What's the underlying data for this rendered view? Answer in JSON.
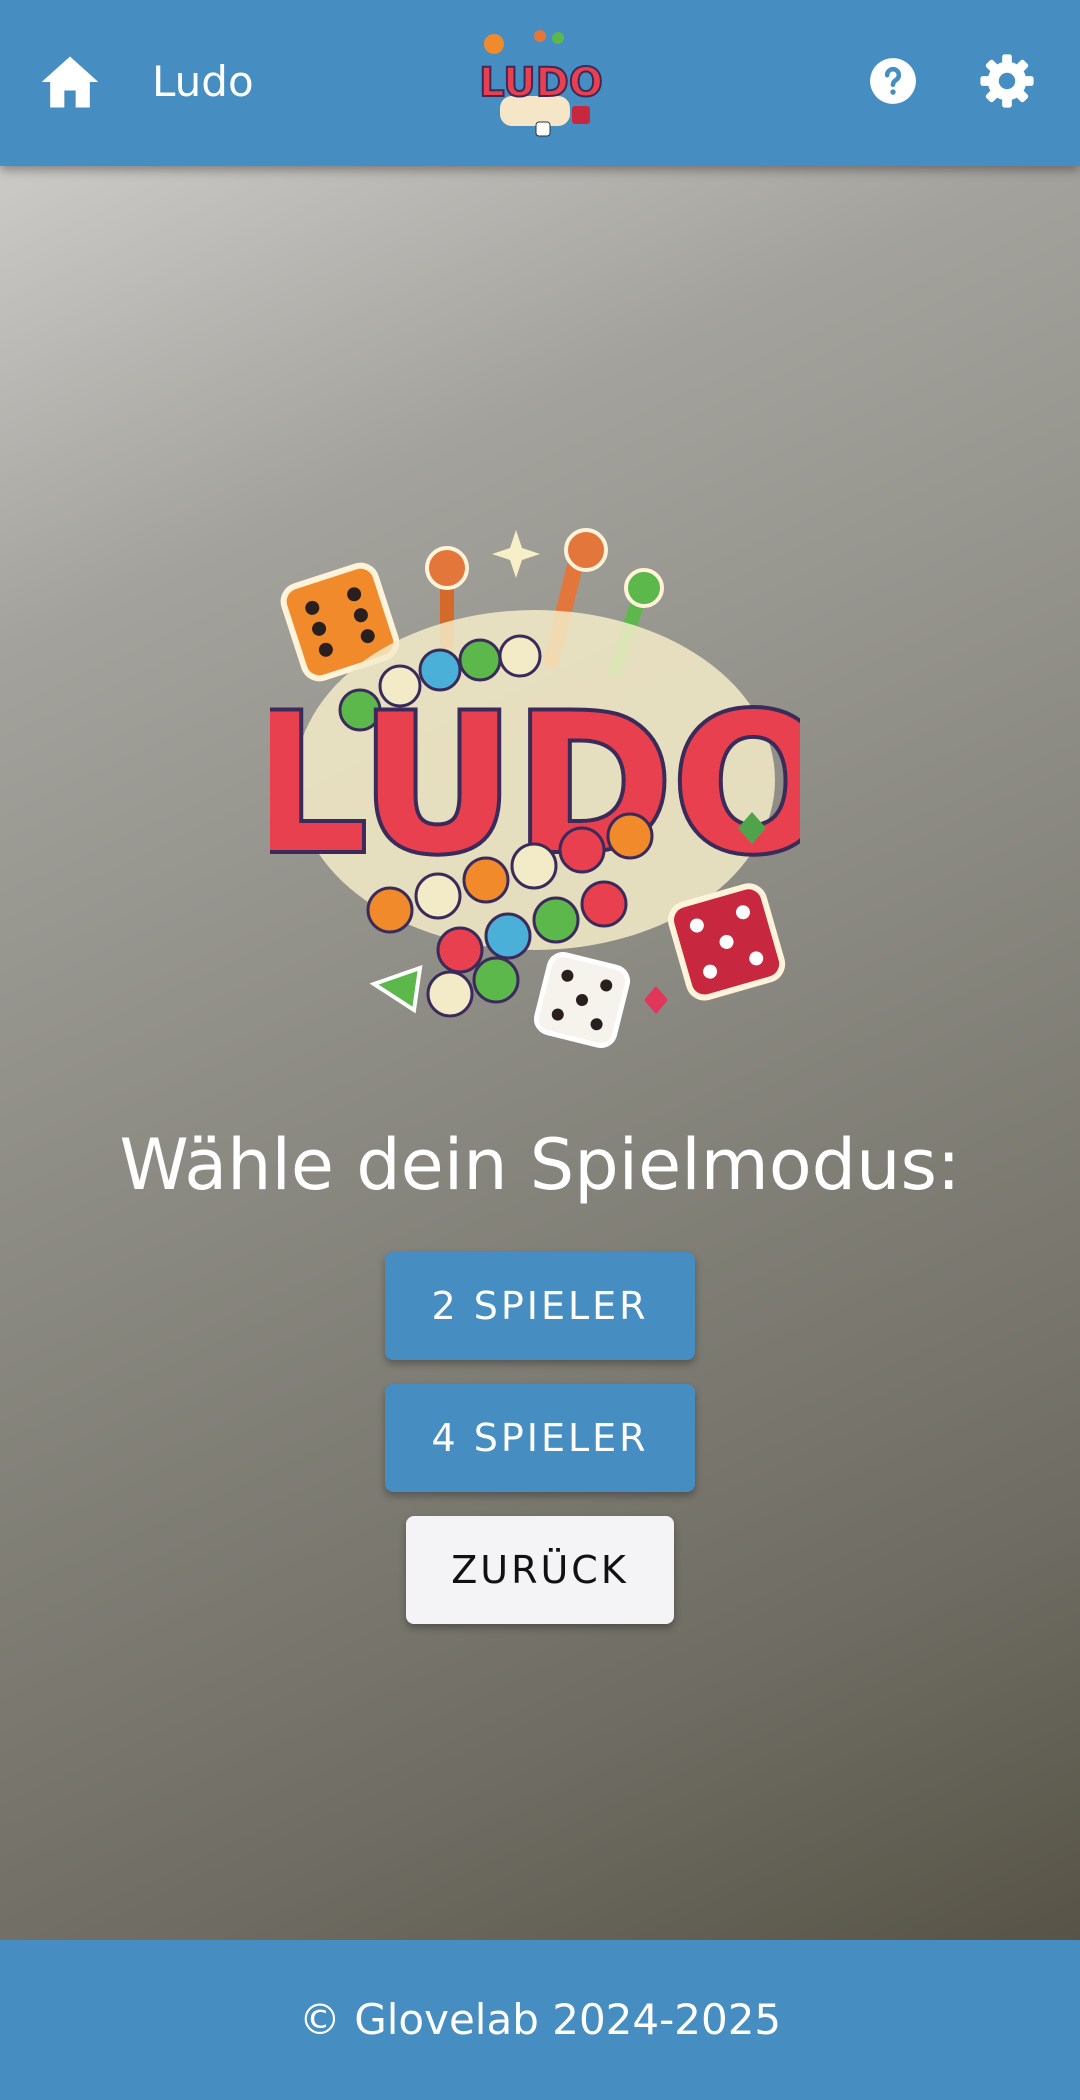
{
  "header": {
    "title": "Ludo",
    "home_icon": "home-icon",
    "help_icon": "help-icon",
    "settings_icon": "settings-icon",
    "logo_text": "LUDO"
  },
  "main": {
    "logo_text": "LUDO",
    "prompt": "Wähle dein Spielmodus:",
    "buttons": {
      "two_players": "2 SPIELER",
      "four_players": "4 SPIELER",
      "back": "ZURÜCK"
    }
  },
  "footer": {
    "copyright": "© Glovelab 2024-2025"
  },
  "colors": {
    "primary": "#468dc2",
    "back_button": "#f4f4f6",
    "text_light": "#ffffff"
  }
}
